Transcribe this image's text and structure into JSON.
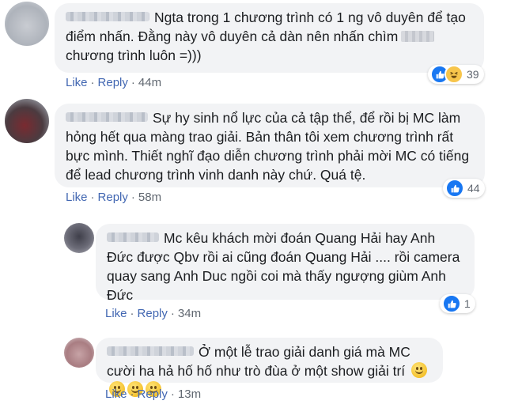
{
  "comments": [
    {
      "text": "Ngta trong 1 chương trình có 1 ng vô duyên để tạo điểm nhấn. Đằng này vô duyên cả dàn nên nhấn chìm",
      "text_after": "chương trình luôn =)))",
      "like_label": "Like",
      "reply_label": "Reply",
      "time": "44m",
      "reaction_count": "39",
      "reaction_icons": [
        "like-icon",
        "haha-icon"
      ]
    },
    {
      "text": "Sự hy sinh nổ lực của cả tập thể, để rồi bị MC làm hỏng hết qua màng trao giải. Bản thân tôi xem chương trình rất bực mình. Thiết nghĩ đạo diễn chương trình phải mời MC có tiếng để lead chương trình vinh danh này chứ. Quá tệ.",
      "like_label": "Like",
      "reply_label": "Reply",
      "time": "58m",
      "reaction_count": "44",
      "reaction_icons": [
        "like-icon"
      ]
    },
    {
      "text": "Mc kêu khách mời đoán Quang Hải hay Anh Đức được Qbv rồi ai cũng đoán Quang Hải .... rồi camera quay sang Anh Duc ngồi coi mà thấy ngượng giùm Anh Đức",
      "like_label": "Like",
      "reply_label": "Reply",
      "time": "34m",
      "reaction_count": "1",
      "reaction_icons": [
        "like-icon"
      ]
    },
    {
      "text": "Ở một lễ trao giải danh giá mà MC cười ha hả hố hố như trò đùa ở một show giải trí",
      "emojis": [
        "smile-emoji",
        "smile-emoji",
        "smile-emoji",
        "smile-emoji"
      ],
      "like_label": "Like",
      "reply_label": "Reply",
      "time": "13m"
    }
  ],
  "colors": {
    "bubble_bg": "#f2f3f5",
    "link": "#4267b2",
    "meta": "#606770",
    "like_blue": "#1877f2"
  }
}
